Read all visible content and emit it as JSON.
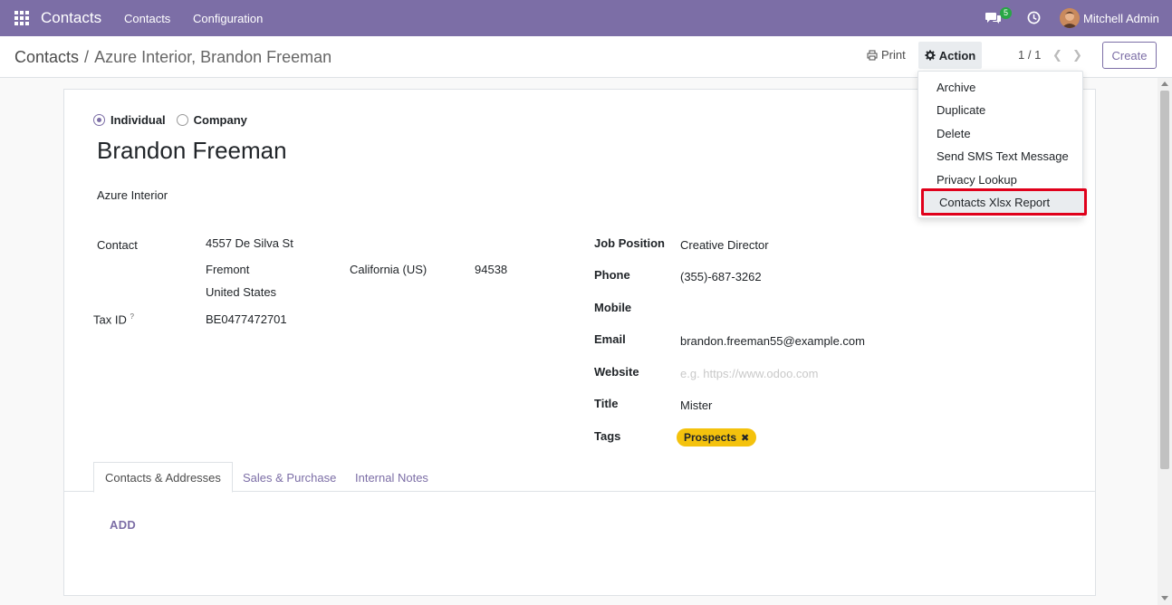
{
  "navbar": {
    "app_name": "Contacts",
    "menu": [
      "Contacts",
      "Configuration"
    ],
    "chat_count": "5",
    "user_name": "Mitchell Admin",
    "brand_color": "#7c6ea6"
  },
  "breadcrumb": {
    "root": "Contacts",
    "separator": "/",
    "current": "Azure Interior, Brandon Freeman"
  },
  "toolbar": {
    "print_label": "Print",
    "action_label": "Action",
    "pager": "1 / 1",
    "create_label": "Create"
  },
  "action_menu": {
    "items": [
      "Archive",
      "Duplicate",
      "Delete",
      "Send SMS Text Message",
      "Privacy Lookup",
      "Contacts Xlsx Report"
    ],
    "highlighted": "Contacts Xlsx Report",
    "highlight_color": "#e0001b"
  },
  "form": {
    "type_options": [
      "Individual",
      "Company"
    ],
    "type_selected": "Individual",
    "name": "Brandon Freeman",
    "company": "Azure Interior",
    "address": {
      "label": "Contact",
      "street": "4557 De Silva St",
      "city": "Fremont",
      "state": "California (US)",
      "zip": "94538",
      "country": "United States"
    },
    "tax_id": {
      "label": "Tax ID",
      "help": "?",
      "value": "BE0477472701"
    },
    "job_position": {
      "label": "Job Position",
      "value": "Creative Director"
    },
    "phone": {
      "label": "Phone",
      "value": "(355)-687-3262"
    },
    "mobile": {
      "label": "Mobile",
      "value": ""
    },
    "email": {
      "label": "Email",
      "value": "brandon.freeman55@example.com"
    },
    "website": {
      "label": "Website",
      "placeholder": "e.g. https://www.odoo.com"
    },
    "title": {
      "label": "Title",
      "value": "Mister"
    },
    "tags": {
      "label": "Tags",
      "items": [
        "Prospects"
      ],
      "tag_color": "#f4c20d"
    }
  },
  "notebook": {
    "tabs": [
      "Contacts & Addresses",
      "Sales & Purchase",
      "Internal Notes"
    ],
    "active_tab": "Contacts & Addresses",
    "add_label": "ADD"
  }
}
